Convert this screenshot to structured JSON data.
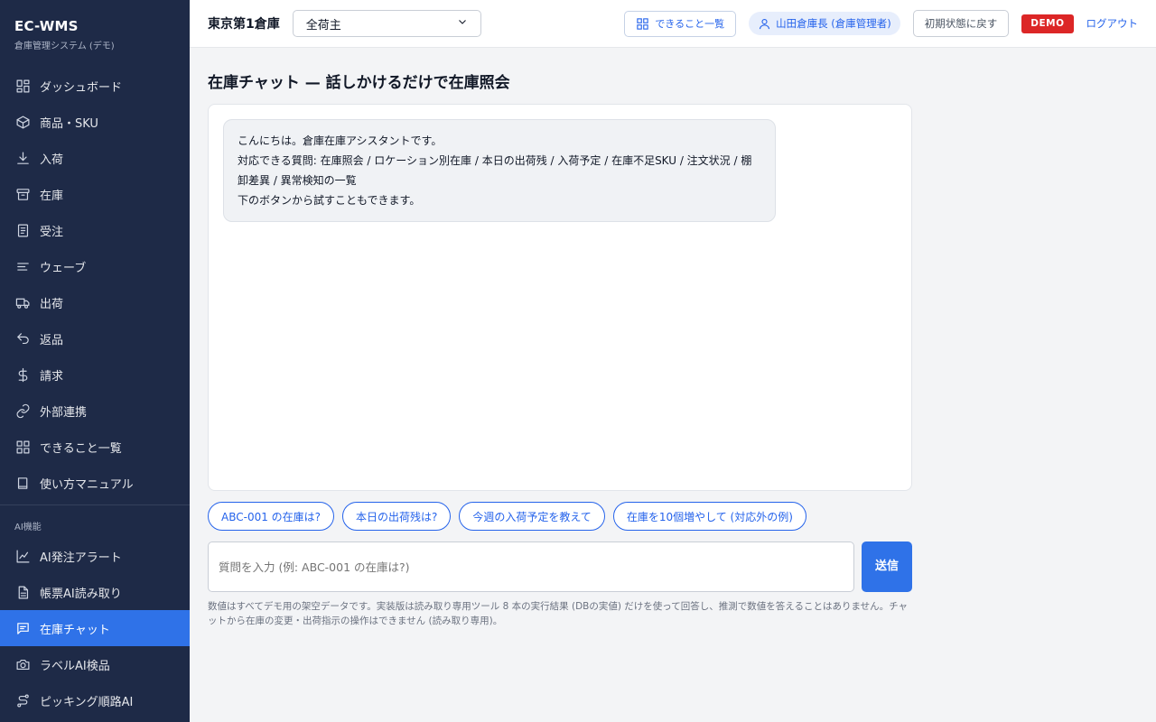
{
  "brand": {
    "title": "EC-WMS",
    "subtitle": "倉庫管理システム (デモ)"
  },
  "sidebar": {
    "items": [
      {
        "label": "ダッシュボード",
        "icon": "dashboard-icon"
      },
      {
        "label": "商品・SKU",
        "icon": "box-icon"
      },
      {
        "label": "入荷",
        "icon": "download-icon"
      },
      {
        "label": "在庫",
        "icon": "archive-icon"
      },
      {
        "label": "受注",
        "icon": "document-icon"
      },
      {
        "label": "ウェーブ",
        "icon": "lines-icon"
      },
      {
        "label": "出荷",
        "icon": "truck-icon"
      },
      {
        "label": "返品",
        "icon": "undo-icon"
      },
      {
        "label": "請求",
        "icon": "dollar-icon"
      },
      {
        "label": "外部連携",
        "icon": "link-icon"
      },
      {
        "label": "できること一覧",
        "icon": "grid-icon"
      },
      {
        "label": "使い方マニュアル",
        "icon": "book-icon"
      }
    ],
    "section_label": "AI機能",
    "ai_items": [
      {
        "label": "AI発注アラート",
        "icon": "chart-line-icon"
      },
      {
        "label": "帳票AI読み取り",
        "icon": "file-text-icon"
      },
      {
        "label": "在庫チャット",
        "icon": "chat-icon",
        "active": true
      },
      {
        "label": "ラベルAI検品",
        "icon": "camera-icon"
      },
      {
        "label": "ピッキング順路AI",
        "icon": "route-icon"
      }
    ]
  },
  "header": {
    "warehouse": "東京第1倉庫",
    "shipper_select": {
      "selected": "全荷主"
    },
    "features_label": "できること一覧",
    "user_label": "山田倉庫長 (倉庫管理者)",
    "reset_label": "初期状態に戻す",
    "demo_badge": "DEMO",
    "logout_label": "ログアウト"
  },
  "page": {
    "title": "在庫チャット — 話しかけるだけで在庫照会",
    "assistant_message": {
      "line1": "こんにちは。倉庫在庫アシスタントです。",
      "line2": "対応できる質問: 在庫照会 / ロケーション別在庫 / 本日の出荷残 / 入荷予定 / 在庫不足SKU / 注文状況 / 棚卸差異 / 異常検知の一覧",
      "line3": "下のボタンから試すこともできます。"
    },
    "suggestions": [
      "ABC-001 の在庫は?",
      "本日の出荷残は?",
      "今週の入荷予定を教えて",
      "在庫を10個増やして (対応外の例)"
    ],
    "input": {
      "placeholder": "質問を入力 (例: ABC-001 の在庫は?)",
      "value": ""
    },
    "send_label": "送信",
    "footnote": "数値はすべてデモ用の架空データです。実装版は読み取り専用ツール 8 本の実行結果 (DBの実値) だけを使って回答し、推測で数値を答えることはありません。チャットから在庫の変更・出荷指示の操作はできません (読み取り専用)。"
  },
  "colors": {
    "sidebar_bg": "#1e2a47",
    "accent": "#2f72e8",
    "link": "#2563eb",
    "demo_red": "#dc2626"
  }
}
